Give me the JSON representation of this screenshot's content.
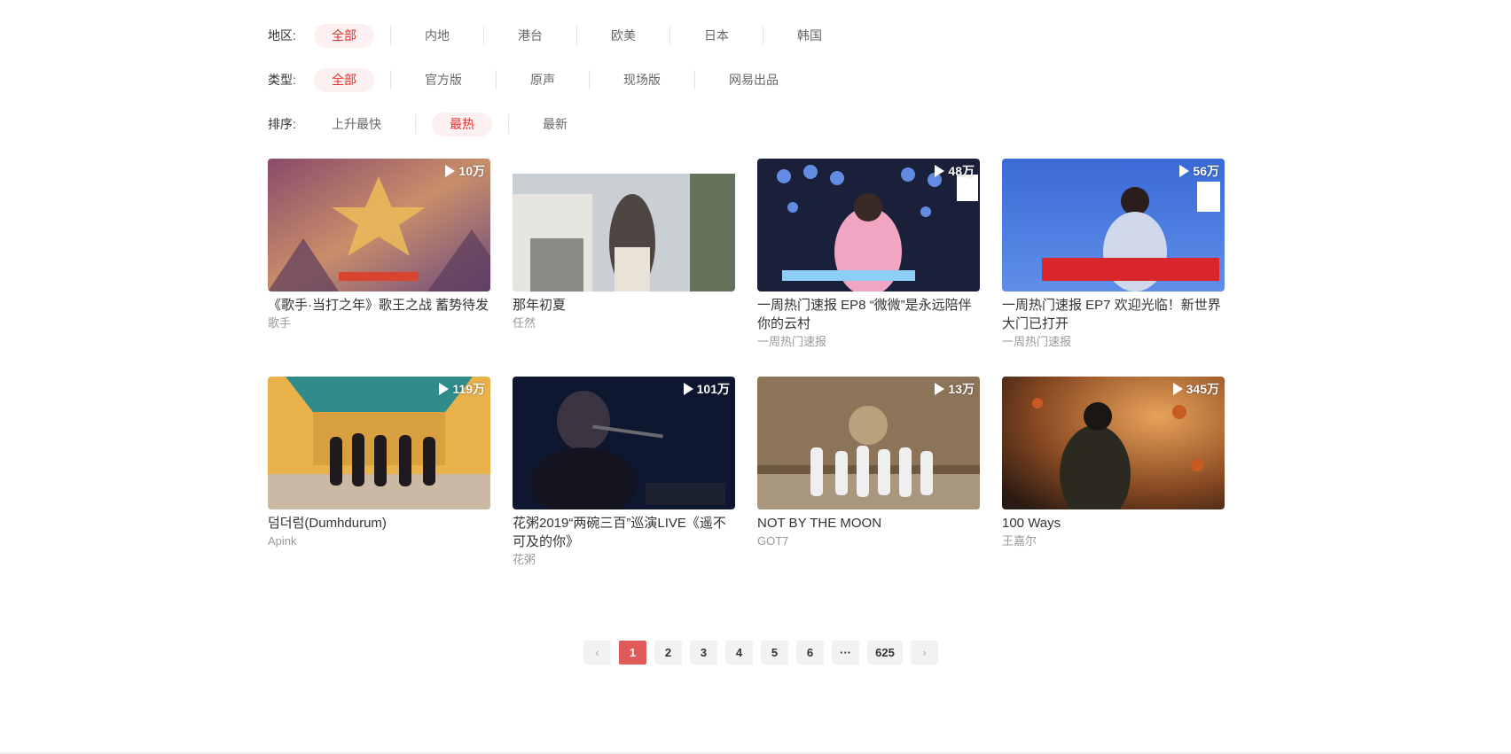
{
  "filters": {
    "region": {
      "label": "地区:",
      "options": [
        "全部",
        "内地",
        "港台",
        "欧美",
        "日本",
        "韩国"
      ],
      "active": 0
    },
    "type": {
      "label": "类型:",
      "options": [
        "全部",
        "官方版",
        "原声",
        "现场版",
        "网易出品"
      ],
      "active": 0
    },
    "sort": {
      "label": "排序:",
      "options": [
        "上升最快",
        "最热",
        "最新"
      ],
      "active": 1
    }
  },
  "videos": [
    {
      "title": "《歌手·当打之年》歌王之战 蓄势待发",
      "author": "歌手",
      "plays": "10万"
    },
    {
      "title": "那年初夏",
      "author": "任然",
      "plays": ""
    },
    {
      "title": "一周热门速报 EP8 “微微”是永远陪伴你的云村",
      "author": "一周热门速报",
      "plays": "48万"
    },
    {
      "title": "一周热门速报 EP7 欢迎光临！新世界大门已打开",
      "author": "一周热门速报",
      "plays": "56万"
    },
    {
      "title": "덤더럼(Dumhdurum)",
      "author": "Apink",
      "plays": "119万"
    },
    {
      "title": "花粥2019“两碗三百”巡演LIVE《遥不可及的你》",
      "author": "花粥",
      "plays": "101万"
    },
    {
      "title": "NOT BY THE MOON",
      "author": "GOT7",
      "plays": "13万"
    },
    {
      "title": "100 Ways",
      "author": "王嘉尔",
      "plays": "345万"
    }
  ],
  "pagination": {
    "prev": "‹",
    "pages": [
      "1",
      "2",
      "3",
      "4",
      "5",
      "6"
    ],
    "ellipsis": "···",
    "last": "625",
    "next": "›",
    "current": "1"
  }
}
